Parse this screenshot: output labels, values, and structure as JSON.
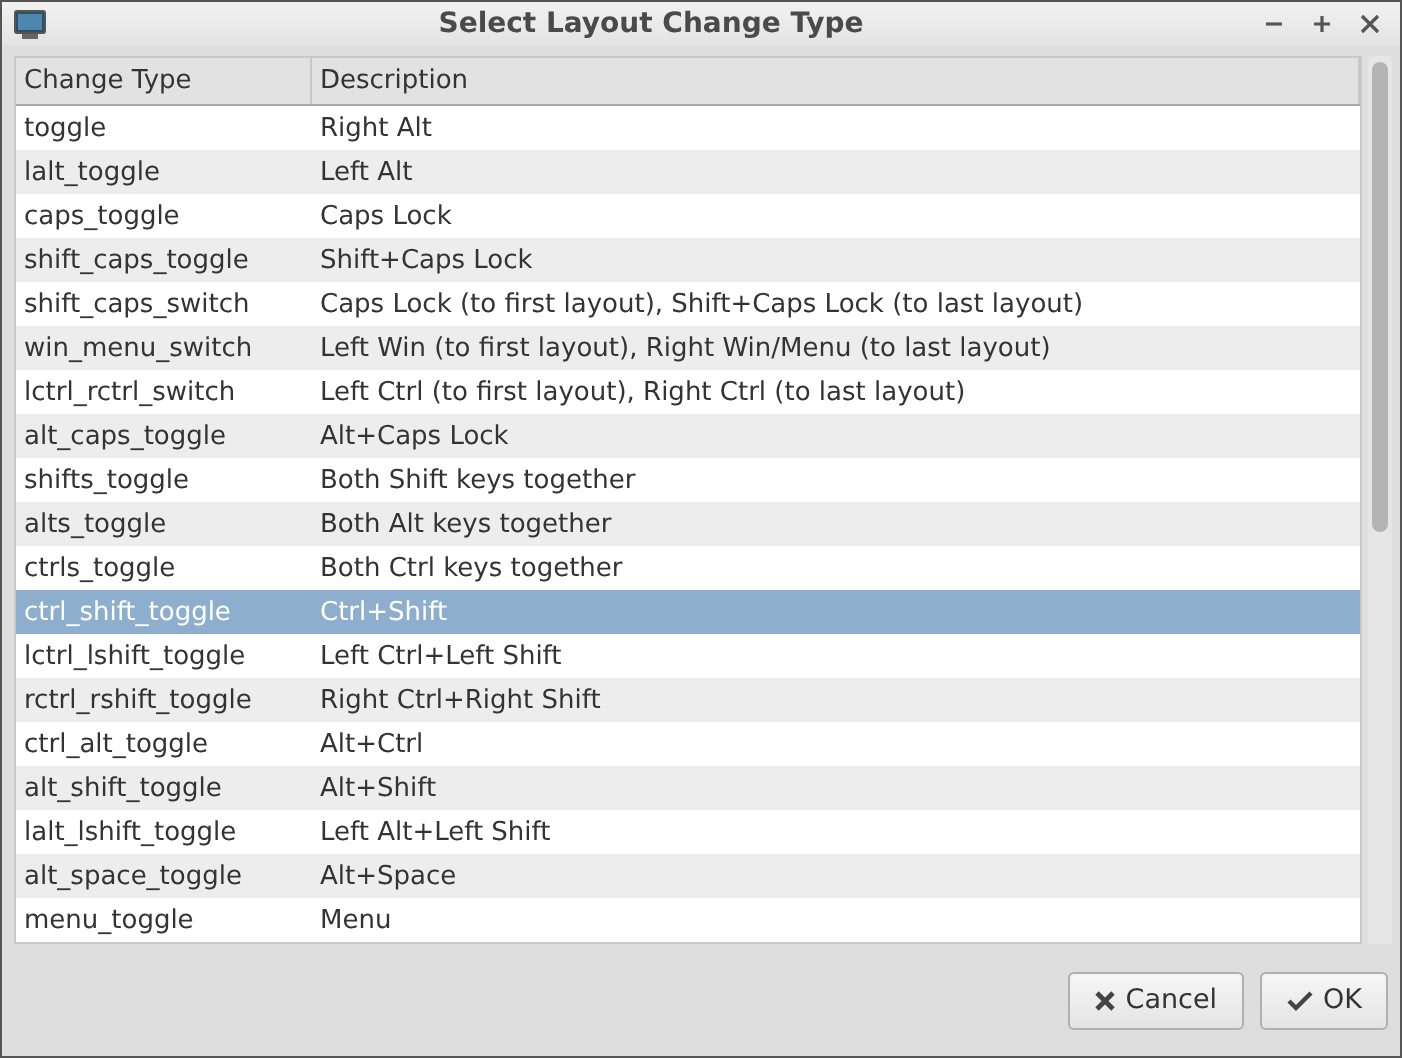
{
  "window": {
    "title": "Select Layout Change Type"
  },
  "table": {
    "columns": [
      "Change Type",
      "Description"
    ],
    "rows": [
      {
        "cells": [
          "toggle",
          "Right Alt"
        ],
        "selected": false
      },
      {
        "cells": [
          "lalt_toggle",
          "Left Alt"
        ],
        "selected": false
      },
      {
        "cells": [
          "caps_toggle",
          "Caps Lock"
        ],
        "selected": false
      },
      {
        "cells": [
          "shift_caps_toggle",
          "Shift+Caps Lock"
        ],
        "selected": false
      },
      {
        "cells": [
          "shift_caps_switch",
          "Caps Lock (to first layout), Shift+Caps Lock (to last layout)"
        ],
        "selected": false
      },
      {
        "cells": [
          "win_menu_switch",
          "Left Win (to first layout), Right Win/Menu (to last layout)"
        ],
        "selected": false
      },
      {
        "cells": [
          "lctrl_rctrl_switch",
          "Left Ctrl (to first layout), Right Ctrl (to last layout)"
        ],
        "selected": false
      },
      {
        "cells": [
          "alt_caps_toggle",
          "Alt+Caps Lock"
        ],
        "selected": false
      },
      {
        "cells": [
          "shifts_toggle",
          "Both Shift keys together"
        ],
        "selected": false
      },
      {
        "cells": [
          "alts_toggle",
          "Both Alt keys together"
        ],
        "selected": false
      },
      {
        "cells": [
          "ctrls_toggle",
          "Both Ctrl keys together"
        ],
        "selected": false
      },
      {
        "cells": [
          "ctrl_shift_toggle",
          "Ctrl+Shift"
        ],
        "selected": true
      },
      {
        "cells": [
          "lctrl_lshift_toggle",
          "Left Ctrl+Left Shift"
        ],
        "selected": false
      },
      {
        "cells": [
          "rctrl_rshift_toggle",
          "Right Ctrl+Right Shift"
        ],
        "selected": false
      },
      {
        "cells": [
          "ctrl_alt_toggle",
          "Alt+Ctrl"
        ],
        "selected": false
      },
      {
        "cells": [
          "alt_shift_toggle",
          "Alt+Shift"
        ],
        "selected": false
      },
      {
        "cells": [
          "lalt_lshift_toggle",
          "Left Alt+Left Shift"
        ],
        "selected": false
      },
      {
        "cells": [
          "alt_space_toggle",
          "Alt+Space"
        ],
        "selected": false
      },
      {
        "cells": [
          "menu_toggle",
          "Menu"
        ],
        "selected": false
      }
    ]
  },
  "buttons": [
    {
      "kind": "cancel",
      "label": "Cancel"
    },
    {
      "kind": "ok",
      "label": "OK"
    }
  ]
}
